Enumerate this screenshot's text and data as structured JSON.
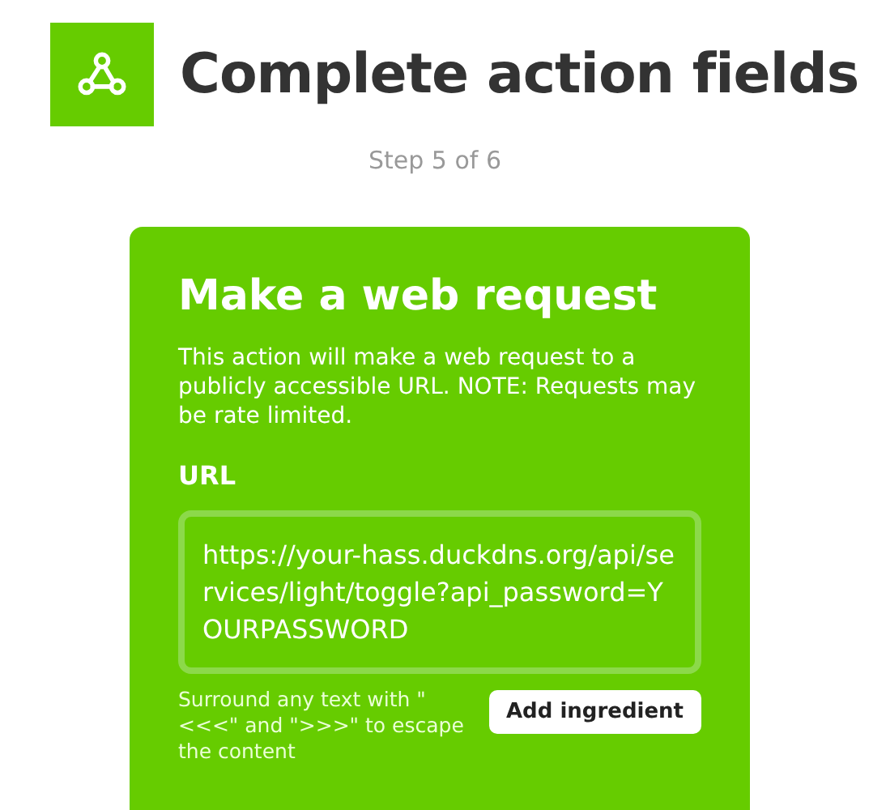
{
  "header": {
    "title": "Complete action fields",
    "step": "Step 5 of 6"
  },
  "card": {
    "title": "Make a web request",
    "description": "This action will make a web request to a publicly accessible URL. NOTE: Requests may be rate limited.",
    "field": {
      "label": "URL",
      "value": "https://your-hass.duckdns.org/api/services/light/toggle?api_password=YOURPASSWORD",
      "hint": "Surround any text with \"<<<\" and \">>>\" to escape the content",
      "button": "Add ingredient"
    }
  }
}
